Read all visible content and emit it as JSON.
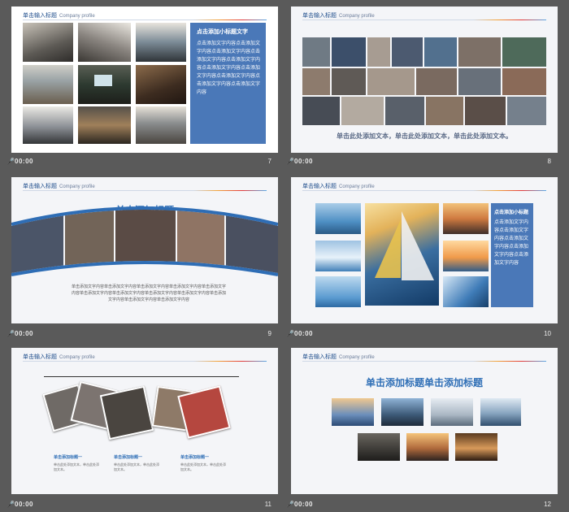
{
  "header": {
    "title_cn": "单击输入标题",
    "title_en": "Company profile"
  },
  "slides": [
    {
      "footer": {
        "mic": "🎤",
        "time": "00:00",
        "num": "7"
      },
      "box_title": "点击添加小标题文字",
      "box_body": "点击添加文字内容点击添加文字内容点击添加文字内容点击添加文字内容点击添加文字内容点击添加文字内容点击添加文字内容点击添加文字内容点击添加文字内容点击添加文字内容"
    },
    {
      "footer": {
        "mic": "🎤",
        "time": "00:00",
        "num": "8"
      },
      "caption": "单击此处添加文本，单击此处添加文本，单击此处添加文本。"
    },
    {
      "footer": {
        "mic": "🎤",
        "time": "00:00",
        "num": "9"
      },
      "title": "单击添加标题",
      "body": "单击添加文字内容单击添加文字内容单击添加文字内容单击添加文字内容单击添加文字内容单击添加文字内容单击添加文字内容单击添加文字内容单击添加文字内容单击添加文字内容单击添加文字内容单击添加文字内容"
    },
    {
      "footer": {
        "mic": "🎤",
        "time": "00:00",
        "num": "10"
      },
      "box_title": "点击添加小标题",
      "box_body": "点击添加文字内容点击添加文字内容点击添加文字内容点击添加文字内容点击添加文字内容"
    },
    {
      "footer": {
        "mic": "🎤",
        "time": "00:00",
        "num": "11"
      },
      "items": [
        {
          "title": "单击添加标题一",
          "body": "单击此处添加文本，单击此处添加文本。"
        },
        {
          "title": "单击添加标题一",
          "body": "单击此处添加文本，单击此处添加文本。"
        },
        {
          "title": "单击添加标题一",
          "body": "单击此处添加文本，单击此处添加文本。"
        }
      ]
    },
    {
      "footer": {
        "mic": "🎤",
        "time": "00:00",
        "num": "12"
      },
      "title": "单击添加标题单击添加标题"
    }
  ]
}
